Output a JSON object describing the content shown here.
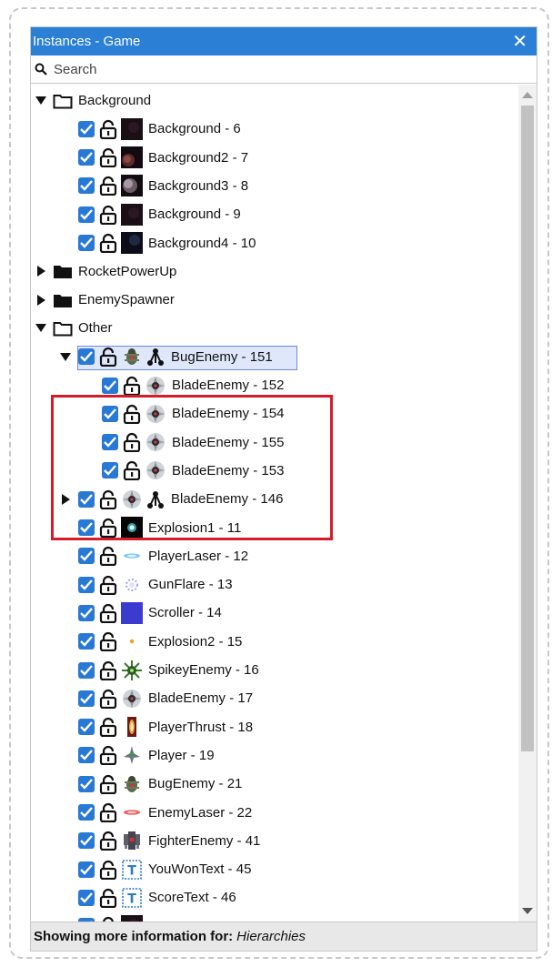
{
  "window": {
    "title": "Instances - Game",
    "close_glyph": "✕"
  },
  "search": {
    "placeholder": "Search",
    "icon": "search-icon"
  },
  "tree": [
    {
      "level": 0,
      "type": "folder",
      "expanded": true,
      "folder_filled": false,
      "label": "Background"
    },
    {
      "level": 1,
      "type": "instance",
      "thumb": "bg-dark",
      "label": "Background - 6"
    },
    {
      "level": 1,
      "type": "instance",
      "thumb": "bg-planet",
      "label": "Background2 - 7"
    },
    {
      "level": 1,
      "type": "instance",
      "thumb": "bg-moon",
      "label": "Background3 - 8"
    },
    {
      "level": 1,
      "type": "instance",
      "thumb": "bg-dark",
      "label": "Background - 9"
    },
    {
      "level": 1,
      "type": "instance",
      "thumb": "bg-blue",
      "label": "Background4 - 10"
    },
    {
      "level": 0,
      "type": "folder",
      "expanded": false,
      "folder_filled": true,
      "label": "RocketPowerUp"
    },
    {
      "level": 0,
      "type": "folder",
      "expanded": false,
      "folder_filled": true,
      "label": "EnemySpawner"
    },
    {
      "level": 0,
      "type": "folder",
      "expanded": true,
      "folder_filled": false,
      "label": "Other"
    },
    {
      "level": 1,
      "type": "instance",
      "expandable": true,
      "expanded": true,
      "selected": true,
      "thumb": "bug",
      "hierarchy": true,
      "label": "BugEnemy - 151"
    },
    {
      "level": 2,
      "type": "instance",
      "thumb": "blade",
      "label": "BladeEnemy - 152"
    },
    {
      "level": 2,
      "type": "instance",
      "thumb": "blade",
      "label": "BladeEnemy - 154"
    },
    {
      "level": 2,
      "type": "instance",
      "thumb": "blade",
      "label": "BladeEnemy - 155"
    },
    {
      "level": 2,
      "type": "instance",
      "thumb": "blade",
      "label": "BladeEnemy - 153"
    },
    {
      "level": 1,
      "type": "instance",
      "expandable": true,
      "expanded": false,
      "thumb": "blade",
      "hierarchy": true,
      "label": "BladeEnemy - 146"
    },
    {
      "level": 1,
      "type": "instance",
      "thumb": "explosion",
      "label": "Explosion1 - 11"
    },
    {
      "level": 1,
      "type": "instance",
      "thumb": "laser-blue",
      "label": "PlayerLaser - 12"
    },
    {
      "level": 1,
      "type": "instance",
      "thumb": "gunflare",
      "label": "GunFlare - 13"
    },
    {
      "level": 1,
      "type": "instance",
      "thumb": "scroller",
      "label": "Scroller - 14"
    },
    {
      "level": 1,
      "type": "instance",
      "thumb": "explosion2",
      "label": "Explosion2 - 15"
    },
    {
      "level": 1,
      "type": "instance",
      "thumb": "spikey",
      "label": "SpikeyEnemy - 16"
    },
    {
      "level": 1,
      "type": "instance",
      "thumb": "blade",
      "label": "BladeEnemy - 17"
    },
    {
      "level": 1,
      "type": "instance",
      "thumb": "thrust",
      "label": "PlayerThrust - 18"
    },
    {
      "level": 1,
      "type": "instance",
      "thumb": "player",
      "label": "Player - 19"
    },
    {
      "level": 1,
      "type": "instance",
      "thumb": "bug",
      "label": "BugEnemy - 21"
    },
    {
      "level": 1,
      "type": "instance",
      "thumb": "laser-red",
      "label": "EnemyLaser - 22"
    },
    {
      "level": 1,
      "type": "instance",
      "thumb": "fighter",
      "label": "FighterEnemy - 41"
    },
    {
      "level": 1,
      "type": "instance",
      "thumb": "text",
      "label": "YouWonText - 45"
    },
    {
      "level": 1,
      "type": "instance",
      "thumb": "text",
      "label": "ScoreText - 46"
    },
    {
      "level": 1,
      "type": "instance",
      "thumb": "bg-dark",
      "label": ""
    }
  ],
  "status": {
    "label": "Showing more information for:",
    "value": "Hierarchies"
  },
  "colors": {
    "accent": "#2b80d5",
    "checkbox": "#2878d6",
    "selection_border": "#6f87e8",
    "selection_fill": "#dfe7fb",
    "highlight_box": "#d31d2a"
  }
}
